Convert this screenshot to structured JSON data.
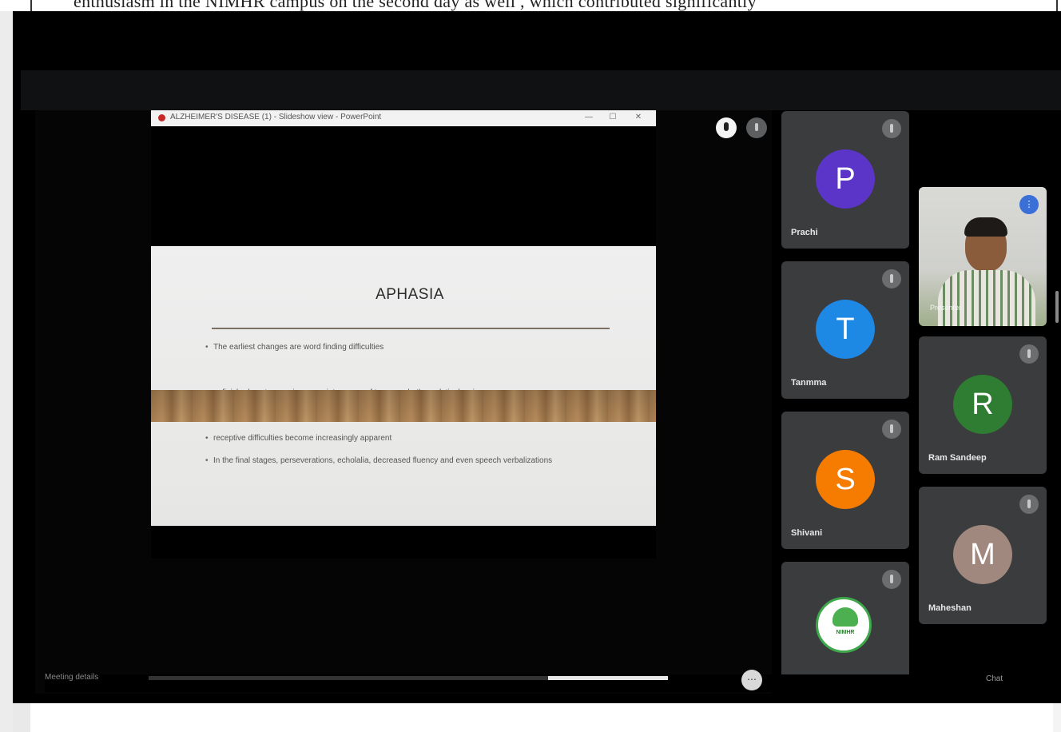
{
  "document": {
    "text_fragment": "enthusiasm in the NIMHR campus on the second day as well , which contributed significantly"
  },
  "window": {
    "title": "ALZHEIMER'S DISEASE (1) - Slideshow view - PowerPoint",
    "controls": [
      "—",
      "☐",
      "✕"
    ]
  },
  "slide": {
    "title": "APHASIA",
    "bullets": [
      "The earliest changes are word finding difficulties",
      "unfinished sentences, inappropriate usage of tense and other relatively minor errors",
      "receptive difficulties become increasingly apparent",
      "In the final stages, perseverations, echolalia, decreased fluency and even speech verbalizations"
    ]
  },
  "participants": [
    {
      "name": "Prachi",
      "initial": "P",
      "color": "#5b35c8"
    },
    {
      "name": "Tanmma",
      "initial": "T",
      "color": "#1e88e5"
    },
    {
      "name": "Shivani",
      "initial": "S",
      "color": "#f57c00"
    },
    {
      "name": "Ram Sandeep",
      "initial": "R",
      "color": "#2e7d32"
    },
    {
      "name": "Maheshan",
      "initial": "M",
      "color": "#a1887f"
    },
    {
      "name": "",
      "initial": "",
      "color": "#ffffff",
      "logo_text": "NIMHR"
    }
  ],
  "video_participant": {
    "name": "Presenter",
    "badge": "⋮"
  },
  "bottom_bar": {
    "left_text": "Meeting details",
    "more": "⋯",
    "right_text": "Chat"
  },
  "icons": {
    "mic": "mic-icon",
    "mute": "mic-off-icon"
  }
}
